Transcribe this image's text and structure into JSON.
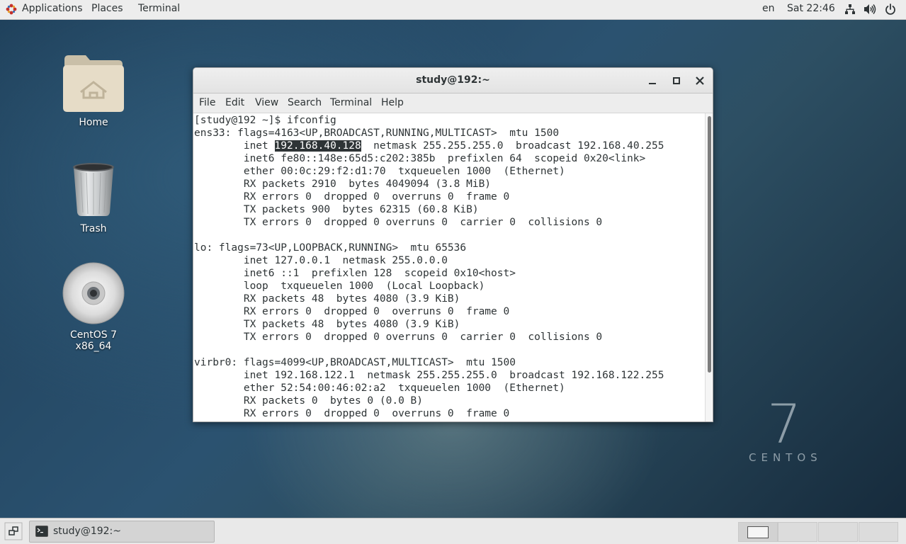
{
  "topbar": {
    "applications": "Applications",
    "places": "Places",
    "terminal": "Terminal",
    "lang": "en",
    "clock": "Sat 22:46",
    "icons": [
      "network-icon",
      "volume-icon",
      "power-icon"
    ]
  },
  "desktop": {
    "icons": [
      {
        "label": "Home",
        "icon": "home-folder-icon"
      },
      {
        "label": "Trash",
        "icon": "trash-icon"
      },
      {
        "label": "CentOS 7 x86_64",
        "icon": "cd-disc-icon"
      }
    ],
    "brand_number": "7",
    "brand_word": "CENTOS"
  },
  "window": {
    "title": "study@192:~",
    "menu": [
      "File",
      "Edit",
      "View",
      "Search",
      "Terminal",
      "Help"
    ],
    "terminal_lines": [
      "[study@192 ~]$ ifconfig",
      "ens33: flags=4163<UP,BROADCAST,RUNNING,MULTICAST>  mtu 1500",
      "        inet ",
      "192.168.40.128",
      "  netmask 255.255.255.0  broadcast 192.168.40.255",
      "        inet6 fe80::148e:65d5:c202:385b  prefixlen 64  scopeid 0x20<link>",
      "        ether 00:0c:29:f2:d1:70  txqueuelen 1000  (Ethernet)",
      "        RX packets 2910  bytes 4049094 (3.8 MiB)",
      "        RX errors 0  dropped 0  overruns 0  frame 0",
      "        TX packets 900  bytes 62315 (60.8 KiB)",
      "        TX errors 0  dropped 0 overruns 0  carrier 0  collisions 0",
      "",
      "lo: flags=73<UP,LOOPBACK,RUNNING>  mtu 65536",
      "        inet 127.0.0.1  netmask 255.0.0.0",
      "        inet6 ::1  prefixlen 128  scopeid 0x10<host>",
      "        loop  txqueuelen 1000  (Local Loopback)",
      "        RX packets 48  bytes 4080 (3.9 KiB)",
      "        RX errors 0  dropped 0  overruns 0  frame 0",
      "        TX packets 48  bytes 4080 (3.9 KiB)",
      "        TX errors 0  dropped 0 overruns 0  carrier 0  collisions 0",
      "",
      "virbr0: flags=4099<UP,BROADCAST,MULTICAST>  mtu 1500",
      "        inet 192.168.122.1  netmask 255.255.255.0  broadcast 192.168.122.255",
      "        ether 52:54:00:46:02:a2  txqueuelen 1000  (Ethernet)",
      "        RX packets 0  bytes 0 (0.0 B)",
      "        RX errors 0  dropped 0  overruns 0  frame 0"
    ]
  },
  "taskbar": {
    "item_label": "study@192:~",
    "workspaces": 4,
    "active_workspace": 1
  }
}
